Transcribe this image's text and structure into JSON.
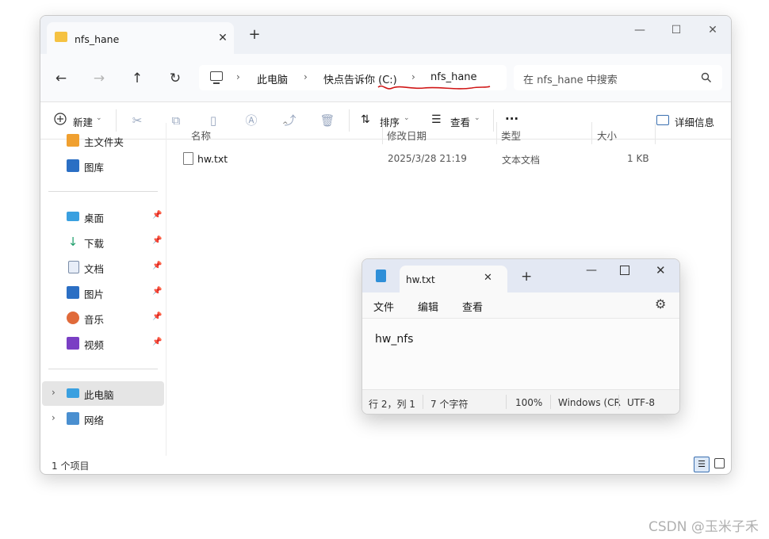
{
  "explorer": {
    "tab_title": "nfs_hane",
    "window_controls": {
      "minimize": "—",
      "maximize": "☐",
      "close": "✕"
    },
    "nav": {
      "back": "←",
      "forward": "→",
      "up": "↑",
      "refresh": "↻"
    },
    "breadcrumb": [
      "此电脑",
      "快点告诉你 (C:)",
      "nfs_hane"
    ],
    "search_placeholder": "在 nfs_hane 中搜索",
    "toolbar": {
      "new_label": "新建",
      "sort_label": "排序",
      "view_label": "查看",
      "more_label": "···",
      "details_label": "详细信息"
    },
    "sidebar": {
      "quick": [
        "主文件夹",
        "图库"
      ],
      "pinned": [
        "桌面",
        "下载",
        "文档",
        "图片",
        "音乐",
        "视频"
      ],
      "locations": [
        "此电脑",
        "网络"
      ]
    },
    "columns": {
      "name": "名称",
      "modified": "修改日期",
      "type": "类型",
      "size": "大小"
    },
    "files": [
      {
        "name": "hw.txt",
        "modified": "2025/3/28 21:19",
        "type": "文本文档",
        "size": "1 KB"
      }
    ],
    "status": "1 个项目",
    "accent": "#d01616"
  },
  "notepad": {
    "tab_title": "hw.txt",
    "menu": {
      "file": "文件",
      "edit": "编辑",
      "view": "查看"
    },
    "content": "hw_nfs",
    "status": {
      "position": "行 2，列 1",
      "chars": "7 个字符",
      "zoom": "100%",
      "eol": "Windows (CR",
      "encoding": "UTF-8"
    }
  },
  "watermark": "CSDN @玉米子禾"
}
